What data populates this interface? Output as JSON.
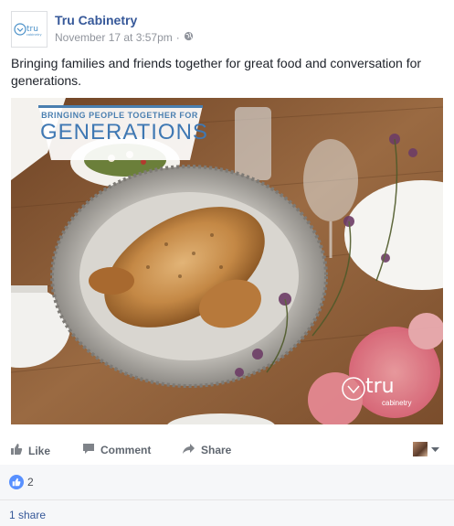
{
  "post": {
    "page_name": "Tru Cabinetry",
    "timestamp": "November 17 at 3:57pm",
    "separator": "·",
    "text": "Bringing families and friends together for great food and conversation for generations.",
    "avatar_logo_text": "tru",
    "avatar_logo_sub": "cabinetry"
  },
  "image": {
    "banner_top": "BRINGING PEOPLE TOGETHER FOR",
    "banner_main": "GENERATIONS",
    "logo_text": "tru",
    "logo_sub": "cabinetry"
  },
  "actions": {
    "like": "Like",
    "comment": "Comment",
    "share": "Share"
  },
  "reactions": {
    "count": "2"
  },
  "shares": {
    "label": "1 share"
  },
  "colors": {
    "link_blue": "#365899",
    "like_blue": "#5890ff",
    "muted": "#90949c"
  }
}
